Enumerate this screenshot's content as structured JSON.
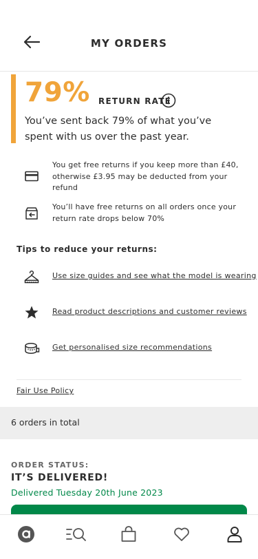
{
  "header": {
    "title": "MY ORDERS",
    "back_icon": "arrow-left-icon"
  },
  "return_rate": {
    "value": "79%",
    "label": "RETURN RATE",
    "description": "You’ve sent back 79% of what you’ve spent with us over the past year.",
    "accent_color": "#f0a43a"
  },
  "info_rows": [
    {
      "icon": "card-icon",
      "text": "You get free returns if you keep more than £40, otherwise £3.95 may be deducted from your refund"
    },
    {
      "icon": "return-box-icon",
      "text": "You’ll have free returns on all orders once your return rate drops below 70%"
    }
  ],
  "tips": {
    "heading": "Tips to reduce your returns:",
    "items": [
      {
        "icon": "hanger-icon",
        "label": "Use size guides and see what the model is wearing"
      },
      {
        "icon": "star-icon",
        "label": "Read product descriptions and customer reviews"
      },
      {
        "icon": "tape-measure-icon",
        "label": "Get personalised size recommendations"
      }
    ]
  },
  "fair_use_policy": "Fair Use Policy",
  "orders_total": "6 orders in total",
  "order_status": {
    "label": "ORDER STATUS:",
    "title": "IT’S DELIVERED!",
    "date": "Delivered Tuesday 20th June 2023",
    "status_color": "#018849"
  },
  "bottom_nav": [
    {
      "name": "home",
      "icon": "asos-logo-icon"
    },
    {
      "name": "search",
      "icon": "search-icon"
    },
    {
      "name": "bag",
      "icon": "bag-icon"
    },
    {
      "name": "saved",
      "icon": "heart-icon"
    },
    {
      "name": "account",
      "icon": "user-icon",
      "active": true
    }
  ]
}
